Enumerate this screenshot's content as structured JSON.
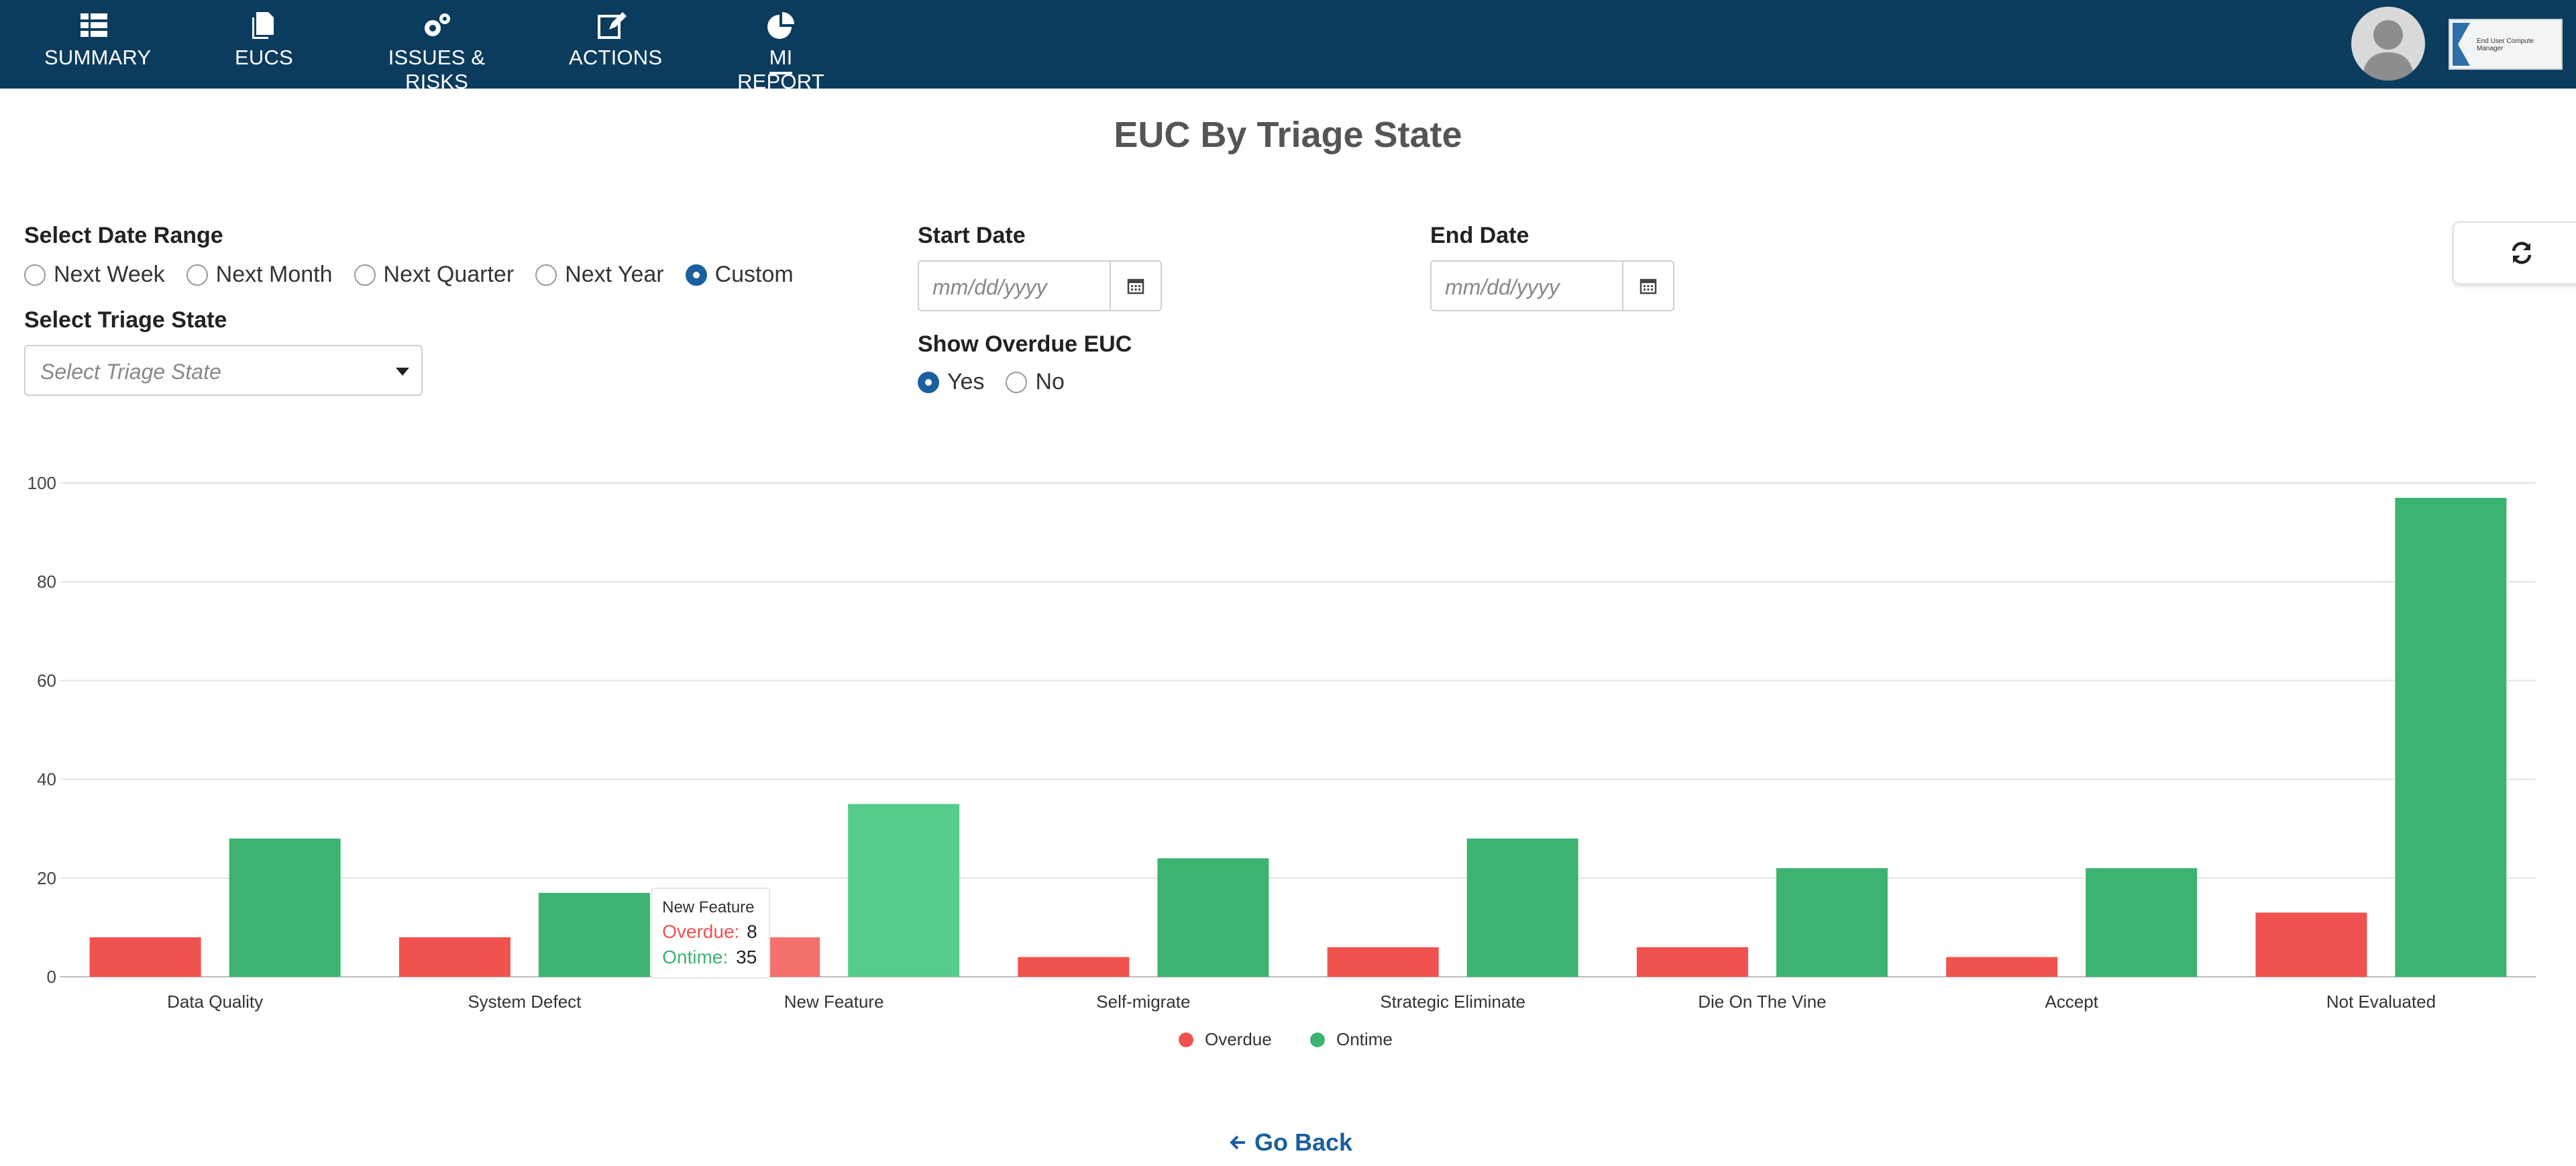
{
  "nav": {
    "items": [
      {
        "label": "SUMMARY",
        "icon": "list-icon"
      },
      {
        "label": "EUCS",
        "icon": "documents-icon"
      },
      {
        "label": "ISSUES & RISKS",
        "icon": "gears-icon"
      },
      {
        "label": "ACTIONS",
        "icon": "edit-icon"
      },
      {
        "label": "MI REPORT",
        "icon": "pie-chart-icon",
        "active": true
      }
    ]
  },
  "header": {
    "logo_text": "End User Compute Manager"
  },
  "page": {
    "title": "EUC By Triage State"
  },
  "filters": {
    "date_range_label": "Select Date Range",
    "date_range_options": [
      "Next Week",
      "Next Month",
      "Next Quarter",
      "Next Year",
      "Custom"
    ],
    "date_range_selected": "Custom",
    "triage_label": "Select Triage State",
    "triage_placeholder": "Select Triage State",
    "start_date_label": "Start Date",
    "start_date_placeholder": "mm/dd/yyyy",
    "end_date_label": "End Date",
    "end_date_placeholder": "mm/dd/yyyy",
    "overdue_label": "Show Overdue EUC",
    "overdue_options": [
      "Yes",
      "No"
    ],
    "overdue_selected": "Yes"
  },
  "chart_data": {
    "type": "bar",
    "categories": [
      "Data Quality",
      "System Defect",
      "New Feature",
      "Self-migrate",
      "Strategic Eliminate",
      "Die On The Vine",
      "Accept",
      "Not Evaluated"
    ],
    "series": [
      {
        "name": "Overdue",
        "color": "#f0524f",
        "values": [
          8,
          8,
          8,
          4,
          6,
          6,
          4,
          13
        ]
      },
      {
        "name": "Ontime",
        "color": "#3cb371",
        "values": [
          28,
          17,
          35,
          24,
          28,
          22,
          22,
          97
        ]
      }
    ],
    "ylim": [
      0,
      100
    ],
    "yticks": [
      0,
      20,
      40,
      60,
      80,
      100
    ],
    "grid": true,
    "legend": "bottom-center",
    "tooltip": {
      "category": "New Feature",
      "overdue_label": "Overdue",
      "overdue_value": "8",
      "ontime_label": "Ontime",
      "ontime_value": "35"
    }
  },
  "footer": {
    "go_back_label": "Go Back"
  },
  "colors": {
    "nav_bg": "#0b3c5d",
    "accent": "#1a5f9e",
    "overdue": "#f0524f",
    "ontime": "#3cb371"
  }
}
